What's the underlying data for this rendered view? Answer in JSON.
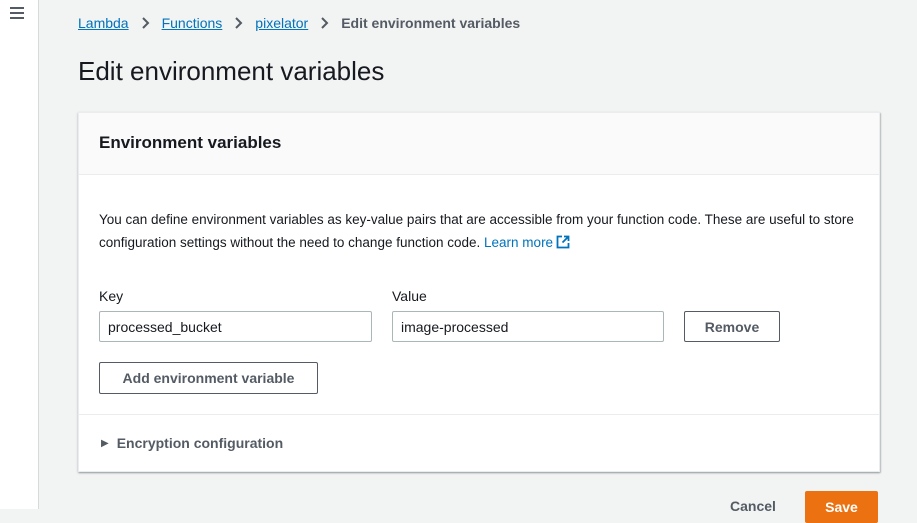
{
  "breadcrumb": {
    "items": [
      "Lambda",
      "Functions",
      "pixelator"
    ],
    "current": "Edit environment variables"
  },
  "page": {
    "title": "Edit environment variables"
  },
  "panel": {
    "title": "Environment variables",
    "description": "You can define environment variables as key-value pairs that are accessible from your function code. These are useful to store configuration settings without the need to change function code.",
    "learn_more": "Learn more"
  },
  "form": {
    "key_label": "Key",
    "value_label": "Value",
    "rows": [
      {
        "key": "processed_bucket",
        "value": "image-processed",
        "remove_label": "Remove"
      }
    ],
    "add_label": "Add environment variable"
  },
  "encryption": {
    "label": "Encryption configuration",
    "expanded": false
  },
  "footer": {
    "cancel_label": "Cancel",
    "save_label": "Save"
  },
  "colors": {
    "link": "#0073bb",
    "primary": "#ec7211",
    "text": "#16191f",
    "secondary_text": "#545b64"
  }
}
